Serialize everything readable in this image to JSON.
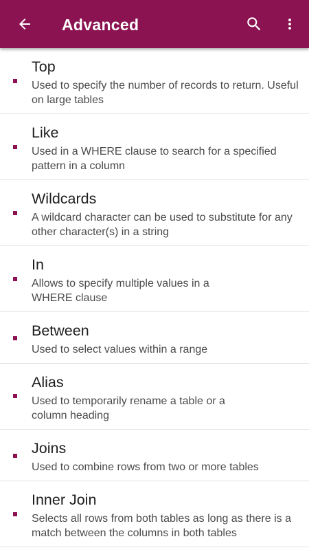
{
  "app_bar": {
    "title": "Advanced",
    "back_icon": "arrow-back-icon",
    "search_icon": "search-icon",
    "more_icon": "more-vert-icon",
    "background_color": "#8c1352"
  },
  "accent_color": "#8c1352",
  "items": [
    {
      "title": "Top",
      "description": "Used to specify the number of records to return. Useful on large tables"
    },
    {
      "title": "Like",
      "description": "Used in a WHERE clause to search for a specified pattern in a column"
    },
    {
      "title": "Wildcards",
      "description": "A wildcard character can be used to substitute for any other character(s) in a string"
    },
    {
      "title": "In",
      "description": "Allows to specify multiple values in a WHERE clause"
    },
    {
      "title": "Between",
      "description": "Used to select values within a range"
    },
    {
      "title": "Alias",
      "description": "Used to temporarily rename a table or a column heading"
    },
    {
      "title": "Joins",
      "description": "Used to combine rows from two or more tables"
    },
    {
      "title": "Inner Join",
      "description": "Selects all rows from both tables as long as there is a match between the columns in both tables"
    }
  ]
}
